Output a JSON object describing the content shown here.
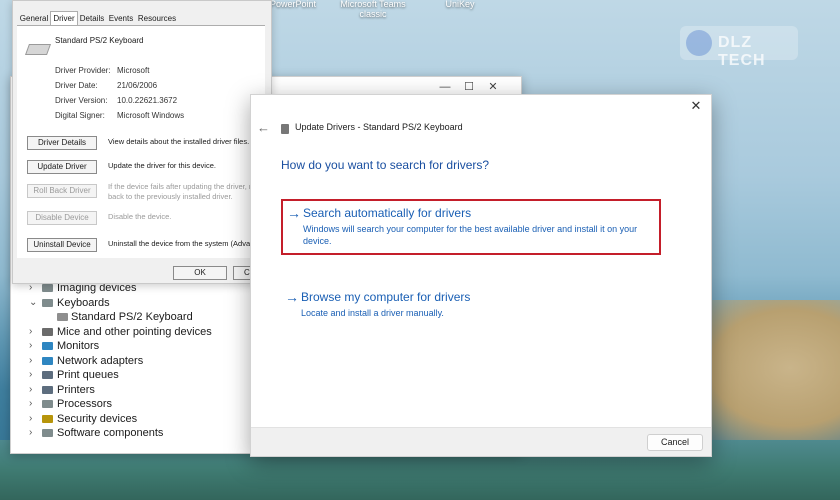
{
  "desktop": {
    "icons": [
      {
        "label": "PowerPoint"
      },
      {
        "label": "Microsoft Teams classic"
      },
      {
        "label": "UniKey"
      }
    ],
    "watermark_text": "DLZ TECH"
  },
  "device_manager": {
    "tree": [
      {
        "label": "Imaging devices",
        "chevron": "›",
        "icon": "camera-icon",
        "color": "#7f8c8d"
      },
      {
        "label": "Keyboards",
        "chevron": "⌄",
        "icon": "keyboard-icon",
        "color": "#7f8c8d"
      },
      {
        "label": "Standard PS/2 Keyboard",
        "chevron": "",
        "icon": "keyboard-icon",
        "color": "#8e8e8e",
        "child": true
      },
      {
        "label": "Mice and other pointing devices",
        "chevron": "›",
        "icon": "mouse-icon",
        "color": "#6b6b6b"
      },
      {
        "label": "Monitors",
        "chevron": "›",
        "icon": "monitor-icon",
        "color": "#2e86c1"
      },
      {
        "label": "Network adapters",
        "chevron": "›",
        "icon": "network-icon",
        "color": "#2e86c1"
      },
      {
        "label": "Print queues",
        "chevron": "›",
        "icon": "printer-icon",
        "color": "#5d6d7e"
      },
      {
        "label": "Printers",
        "chevron": "›",
        "icon": "printer-icon",
        "color": "#5d6d7e"
      },
      {
        "label": "Processors",
        "chevron": "›",
        "icon": "processor-icon",
        "color": "#7f8c8d"
      },
      {
        "label": "Security devices",
        "chevron": "›",
        "icon": "security-icon",
        "color": "#b7950b"
      },
      {
        "label": "Software components",
        "chevron": "›",
        "icon": "software-icon",
        "color": "#7f8c8d"
      }
    ]
  },
  "properties": {
    "tabs": [
      {
        "label": "General"
      },
      {
        "label": "Driver",
        "active": true
      },
      {
        "label": "Details"
      },
      {
        "label": "Events"
      },
      {
        "label": "Resources"
      }
    ],
    "device_name": "Standard PS/2 Keyboard",
    "info": [
      {
        "label": "Driver Provider:",
        "value": "Microsoft"
      },
      {
        "label": "Driver Date:",
        "value": "21/06/2006"
      },
      {
        "label": "Driver Version:",
        "value": "10.0.22621.3672"
      },
      {
        "label": "Digital Signer:",
        "value": "Microsoft Windows"
      }
    ],
    "buttons": [
      {
        "label": "Driver Details",
        "desc": "View details about the installed driver files.",
        "desc2": "",
        "enabled": true
      },
      {
        "label": "Update Driver",
        "desc": "Update the driver for this device.",
        "desc2": "",
        "enabled": true
      },
      {
        "label": "Roll Back Driver",
        "desc": "If the device fails after updating the driver, roll",
        "desc2": "back to the previously installed driver.",
        "enabled": false
      },
      {
        "label": "Disable Device",
        "desc": "Disable the device.",
        "desc2": "",
        "enabled": false
      },
      {
        "label": "Uninstall Device",
        "desc": "Uninstall the device from the system (Advanced",
        "desc2": "",
        "enabled": true
      }
    ],
    "ok_label": "OK",
    "cancel_label": "Cance"
  },
  "update_drivers": {
    "title": "Update Drivers - Standard PS/2 Keyboard",
    "question": "How do you want to search for drivers?",
    "option_auto": {
      "arrow": "→",
      "title": "Search automatically for drivers",
      "desc": "Windows will search your computer for the best available driver and install it on your device."
    },
    "option_browse": {
      "arrow": "→",
      "title": "Browse my computer for drivers",
      "desc": "Locate and install a driver manually."
    },
    "cancel_label": "Cancel",
    "highlight_color": "#c41e2a",
    "link_color": "#1a5fb4"
  }
}
